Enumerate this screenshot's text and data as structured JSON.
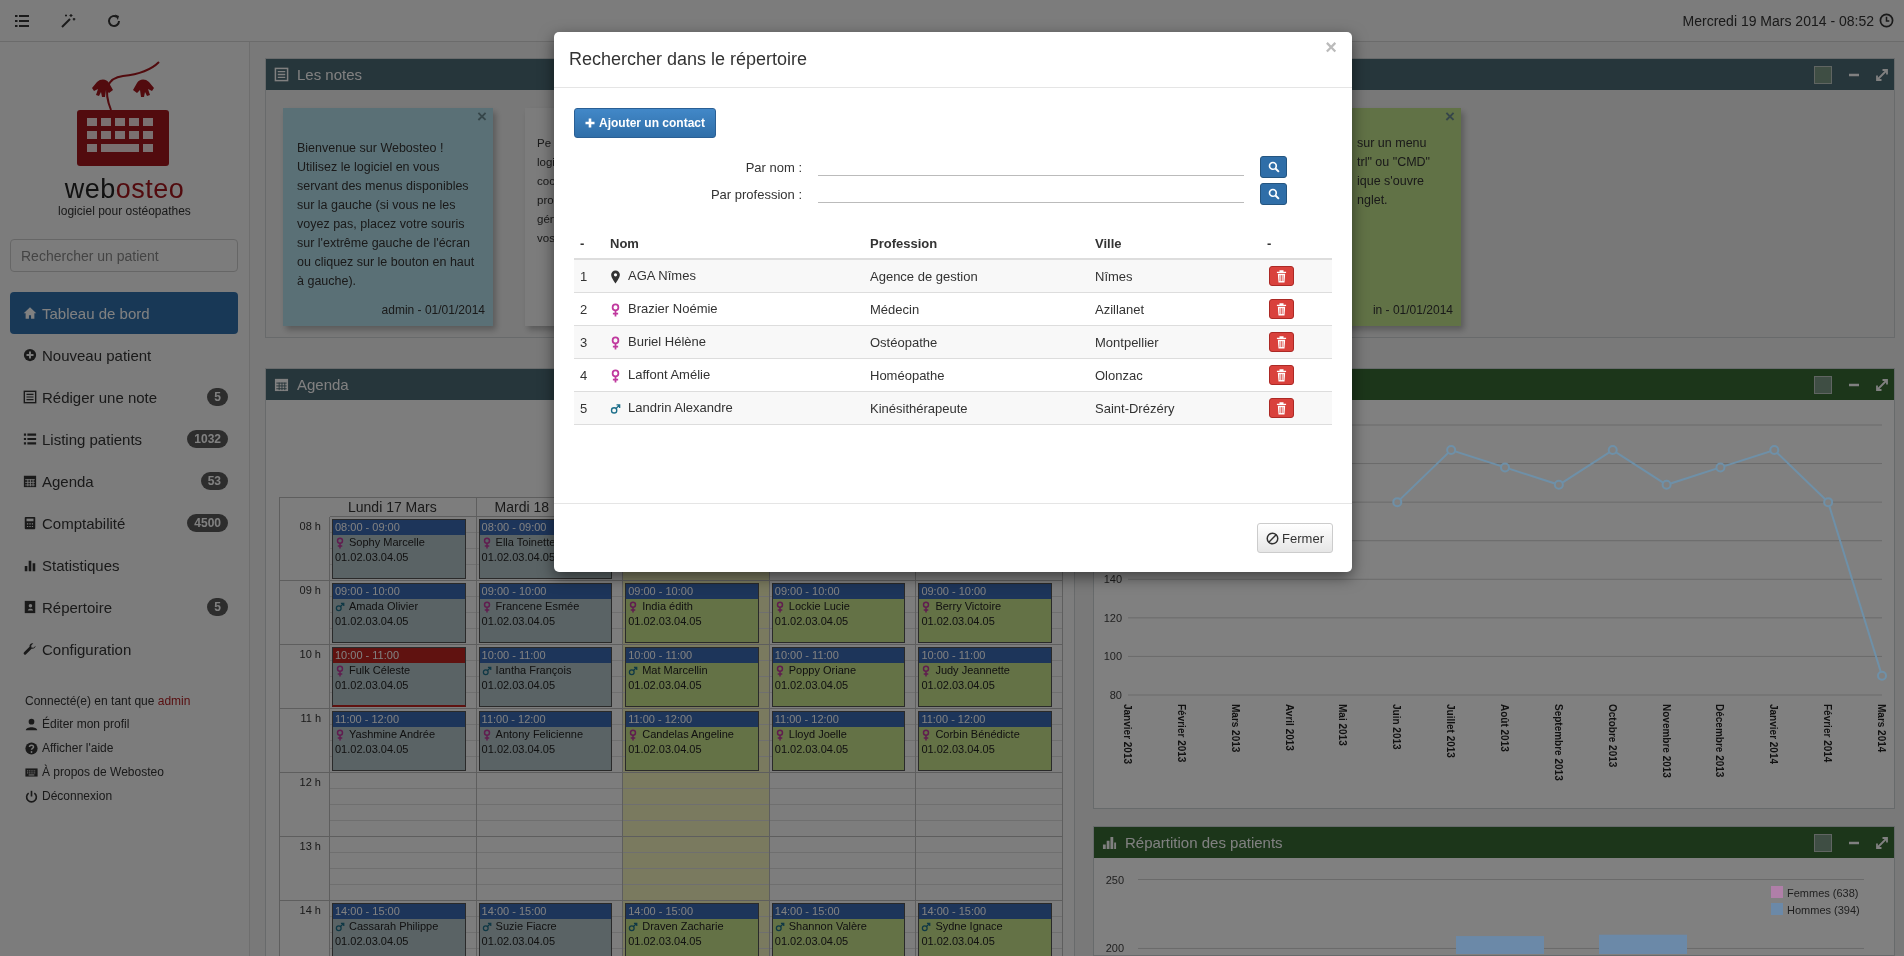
{
  "topbar": {
    "date": "Mercredi 19 Mars 2014 - 08:52"
  },
  "sidebar": {
    "logo": {
      "name_dark": "web",
      "name_accent": "osteo",
      "tagline": "logiciel pour ostéopathes"
    },
    "search": {
      "placeholder": "Rechercher un patient"
    },
    "items": [
      {
        "label": "Tableau de bord",
        "selected": true
      },
      {
        "label": "Nouveau patient",
        "selected": false
      },
      {
        "label": "Rédiger une note",
        "badge": "5",
        "selected": false
      },
      {
        "label": "Listing patients",
        "badge": "1032",
        "selected": false
      },
      {
        "label": "Agenda",
        "badge": "53",
        "selected": false
      },
      {
        "label": "Comptabilité",
        "badge": "4500",
        "selected": false
      },
      {
        "label": "Statistiques",
        "selected": false
      },
      {
        "label": "Répertoire",
        "badge": "5",
        "selected": false
      },
      {
        "label": "Configuration",
        "selected": false
      }
    ],
    "user": {
      "prefix": "Connecté(e) en tant que",
      "name": "admin"
    },
    "links": [
      "Éditer mon profil",
      "Afficher l'aide",
      "À propos de Webosteo",
      "Déconnexion"
    ]
  },
  "notes_panel": {
    "title": "Les notes",
    "notes": [
      {
        "close": "×",
        "text": "Bienvenue sur Webosteo ! Utilisez le logiciel en vous servant des menus disponibles sur la gauche (si vous ne les voyez pas, placez votre souris sur l'extrême gauche de l'écran ou cliquez sur le bouton en haut à gauche).",
        "footer": "admin - 01/01/2014"
      },
      {
        "lines": [
          "Pe",
          "logi",
          "coc",
          "pro",
          "gén",
          "vos"
        ]
      },
      {
        "close": "×",
        "lines": [
          "sur un menu",
          "trl\" ou \"CMD\"",
          "ique s'ouvre",
          "nglet."
        ],
        "footer": "in - 01/01/2014"
      }
    ]
  },
  "agenda": {
    "title": "Agenda",
    "hours": [
      "08 h",
      "09 h",
      "10 h",
      "11 h",
      "12 h",
      "13 h",
      "14 h"
    ],
    "days": [
      {
        "label": "Lundi 17 Mars",
        "today": false,
        "slots": [
          {
            "kind": "done",
            "time": "08:00 - 09:00",
            "patient": {
              "kind": "female",
              "name": "Sophy Marcelle"
            },
            "phone": "01.02.03.04.05"
          },
          {
            "kind": "done",
            "time": "09:00 - 10:00",
            "patient": {
              "kind": "male",
              "name": "Amada Olivier"
            },
            "phone": "01.02.03.04.05"
          },
          {
            "kind": "missed",
            "time": "10:00 - 11:00",
            "patient": {
              "kind": "female",
              "name": "Fulk Céleste"
            },
            "phone": "01.02.03.04.05"
          },
          {
            "kind": "done",
            "time": "11:00 - 12:00",
            "patient": {
              "kind": "female",
              "name": "Yashmine Andrée"
            },
            "phone": "01.02.03.04.05"
          },
          {
            "kind": "free"
          },
          {
            "kind": "free"
          },
          {
            "kind": "done",
            "time": "14:00 - 15:00",
            "patient": {
              "kind": "male",
              "name": "Cassarah Philippe"
            },
            "phone": "01.02.03.04.05"
          }
        ]
      },
      {
        "label": "Mardi 18",
        "today": false,
        "slots": [
          {
            "kind": "done",
            "time": "08:00 - 09:00",
            "patient": {
              "kind": "female",
              "name": "Ella Toinette"
            },
            "phone": "01.02.03.04.05"
          },
          {
            "kind": "done",
            "time": "09:00 - 10:00",
            "patient": {
              "kind": "female",
              "name": "Francene Esmée"
            },
            "phone": "01.02.03.04.05"
          },
          {
            "kind": "done",
            "time": "10:00 - 11:00",
            "patient": {
              "kind": "male",
              "name": "Iantha François"
            },
            "phone": "01.02.03.04.05"
          },
          {
            "kind": "done",
            "time": "11:00 - 12:00",
            "patient": {
              "kind": "female",
              "name": "Antony Felicienne"
            },
            "phone": "01.02.03.04.05"
          },
          {
            "kind": "free"
          },
          {
            "kind": "free"
          },
          {
            "kind": "done",
            "time": "14:00 - 15:00",
            "patient": {
              "kind": "male",
              "name": "Suzie Fiacre"
            },
            "phone": "01.02.03.04.05"
          }
        ]
      },
      {
        "today": true,
        "slots": [
          {
            "kind": "free"
          },
          {
            "kind": "upcoming",
            "time": "09:00 - 10:00",
            "patient": {
              "kind": "female",
              "name": "India édith"
            },
            "phone": "01.02.03.04.05"
          },
          {
            "kind": "upcoming",
            "time": "10:00 - 11:00",
            "patient": {
              "kind": "male",
              "name": "Mat Marcellin"
            },
            "phone": "01.02.03.04.05"
          },
          {
            "kind": "upcoming",
            "time": "11:00 - 12:00",
            "patient": {
              "kind": "female",
              "name": "Candelas Angeline"
            },
            "phone": "01.02.03.04.05"
          },
          {
            "kind": "free"
          },
          {
            "kind": "free"
          },
          {
            "kind": "upcoming",
            "time": "14:00 - 15:00",
            "patient": {
              "kind": "male",
              "name": "Draven Zacharie"
            },
            "phone": "01.02.03.04.05"
          }
        ]
      },
      {
        "today": false,
        "slots": [
          {
            "kind": "free"
          },
          {
            "kind": "upcoming",
            "time": "09:00 - 10:00",
            "patient": {
              "kind": "female",
              "name": "Lockie Lucie"
            },
            "phone": "01.02.03.04.05"
          },
          {
            "kind": "upcoming",
            "time": "10:00 - 11:00",
            "patient": {
              "kind": "female",
              "name": "Poppy Oriane"
            },
            "phone": "01.02.03.04.05"
          },
          {
            "kind": "upcoming",
            "time": "11:00 - 12:00",
            "patient": {
              "kind": "female",
              "name": "Lloyd Joelle"
            },
            "phone": "01.02.03.04.05"
          },
          {
            "kind": "free"
          },
          {
            "kind": "free"
          },
          {
            "kind": "upcoming",
            "time": "14:00 - 15:00",
            "patient": {
              "kind": "male",
              "name": "Shannon Valère"
            },
            "phone": "01.02.03.04.05"
          }
        ]
      },
      {
        "today": false,
        "slots": [
          {
            "kind": "free"
          },
          {
            "kind": "upcoming",
            "time": "09:00 - 10:00",
            "patient": {
              "kind": "female",
              "name": "Berry Victoire"
            },
            "phone": "01.02.03.04.05"
          },
          {
            "kind": "upcoming",
            "time": "10:00 - 11:00",
            "patient": {
              "kind": "female",
              "name": "Judy Jeannette"
            },
            "phone": "01.02.03.04.05"
          },
          {
            "kind": "upcoming",
            "time": "11:00 - 12:00",
            "patient": {
              "kind": "female",
              "name": "Corbin Bénédicte"
            },
            "phone": "01.02.03.04.05"
          },
          {
            "kind": "free"
          },
          {
            "kind": "free"
          },
          {
            "kind": "upcoming",
            "time": "14:00 - 15:00",
            "patient": {
              "kind": "male",
              "name": "Sydne Ignace"
            },
            "phone": "01.02.03.04.05"
          }
        ]
      }
    ]
  },
  "visits_panel": {
    "chart_data": {
      "type": "line",
      "categories": [
        "Janvier 2013",
        "Février 2013",
        "Mars 2013",
        "Avril 2013",
        "Mai 2013",
        "Juin 2013",
        "Juillet 2013",
        "Août 2013",
        "Septembre 2013",
        "Octobre 2013",
        "Novembre 2013",
        "Décembre 2013",
        "Janvier 2014",
        "Février 2014",
        "Mars 2014"
      ],
      "series": [
        {
          "color": "#6e90a8",
          "marker": true,
          "values": [
            null,
            null,
            null,
            null,
            null,
            180,
            207,
            198,
            189,
            207,
            189,
            198,
            207,
            180,
            90
          ]
        }
      ],
      "ylim": [
        80,
        220
      ],
      "yticks": [
        80,
        100,
        120,
        140
      ],
      "grid": true
    }
  },
  "distribution_panel": {
    "title": "Répartition des patients",
    "chart_data": {
      "type": "bar",
      "series": [
        {
          "name": "Femmes (638)",
          "color": "#b07fa8",
          "values": [
            null,
            null
          ]
        },
        {
          "name": "Hommes (394)",
          "color": "#6b89a8",
          "values": [
            209,
            210
          ]
        }
      ],
      "ylim": [
        196,
        250
      ],
      "yticks": [
        200,
        250
      ],
      "grid": true
    }
  },
  "modal": {
    "title": "Rechercher dans le répertoire",
    "close": "×",
    "add_button": "Ajouter un contact",
    "filters": [
      {
        "label": "Par nom :"
      },
      {
        "label": "Par profession :"
      }
    ],
    "columns": [
      "-",
      "Nom",
      "Profession",
      "Ville",
      "-"
    ],
    "rows": [
      {
        "index": "1",
        "kind": "place",
        "name": "AGA Nîmes",
        "profession": "Agence de gestion",
        "city": "Nîmes"
      },
      {
        "index": "2",
        "kind": "female",
        "name": "Brazier Noémie",
        "profession": "Médecin",
        "city": "Azillanet"
      },
      {
        "index": "3",
        "kind": "female",
        "name": "Buriel Hélène",
        "profession": "Ostéopathe",
        "city": "Montpellier"
      },
      {
        "index": "4",
        "kind": "female",
        "name": "Laffont Amélie",
        "profession": "Homéopathe",
        "city": "Olonzac"
      },
      {
        "index": "5",
        "kind": "male",
        "name": "Landrin Alexandre",
        "profession": "Kinésithérapeute",
        "city": "Saint-Drézéry"
      }
    ],
    "close_button": "Fermer"
  }
}
